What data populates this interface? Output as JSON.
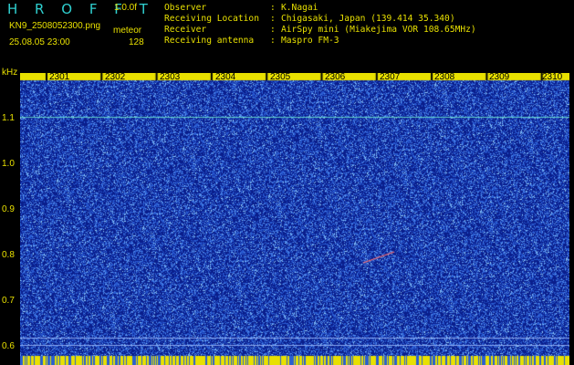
{
  "header": {
    "app_title": "H R O F F T",
    "version": "1.0.0f",
    "filename": "KN9_2508052300.png",
    "mode": "meteor",
    "datetime": "25.08.05 23:00",
    "count": "128",
    "info": [
      {
        "label": "Observer",
        "value": "K.Nagai"
      },
      {
        "label": "Receiving Location",
        "value": "Chigasaki, Japan (139.414 35.340)"
      },
      {
        "label": "Receiver",
        "value": "AirSpy mini (Miakejima VOR 108.65MHz)"
      },
      {
        "label": "Receiving antenna",
        "value": "Maspro FM-3"
      }
    ]
  },
  "spectrogram": {
    "y_unit": "kHz",
    "y_ticks": [
      "1.1",
      "1.0",
      "0.9",
      "0.8",
      "0.7",
      "0.6"
    ],
    "x_ticks": [
      "2301",
      "2302",
      "2303",
      "2304",
      "2305",
      "2306",
      "2307",
      "2308",
      "2309",
      "2310"
    ],
    "colors": {
      "background": "#0a1c8c",
      "noise": "#2f6ad8",
      "signal": "#e8e000",
      "carrier": "#5fd0c8"
    }
  }
}
